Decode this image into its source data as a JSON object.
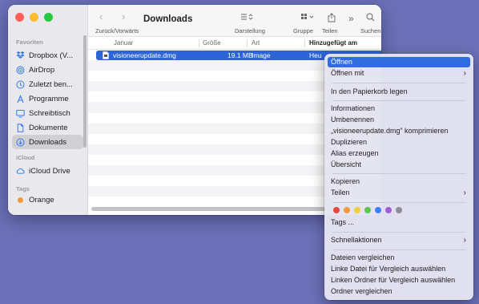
{
  "sidebar": {
    "favorites_header": "Favoriten",
    "items": [
      {
        "label": "Dropbox (V...",
        "icon": "dropbox-icon"
      },
      {
        "label": "AirDrop",
        "icon": "airdrop-icon"
      },
      {
        "label": "Zuletzt ben...",
        "icon": "clock-icon"
      },
      {
        "label": "Programme",
        "icon": "apps-icon"
      },
      {
        "label": "Schreibtisch",
        "icon": "desktop-icon"
      },
      {
        "label": "Dokumente",
        "icon": "document-icon"
      },
      {
        "label": "Downloads",
        "icon": "downloads-icon"
      }
    ],
    "icloud_header": "iCloud",
    "icloud_drive": "iCloud Drive",
    "tags_header": "Tags",
    "tag_orange": "Orange"
  },
  "toolbar": {
    "nav_label": "Zurück/Vorwärts",
    "title": "Downloads",
    "view_label": "Darstellung",
    "group_label": "Gruppe",
    "share_label": "Teilen",
    "search_label": "Suchen"
  },
  "columns": {
    "date": "Januar",
    "size": "Größe",
    "kind": "Art",
    "added": "Hinzugefügt am"
  },
  "file": {
    "name": "visioneerupdate.dmg",
    "size": "19.1 MB",
    "kind": "Image",
    "added": "Heu"
  },
  "menu": {
    "open": "Öffnen",
    "open_with": "Öffnen mit",
    "trash": "In den Papierkorb legen",
    "info": "Informationen",
    "rename": "Umbenennen",
    "compress": "„visioneerupdate.dmg“ komprimieren",
    "duplicate": "Duplizieren",
    "alias": "Alias erzeugen",
    "overview": "Übersicht",
    "copy": "Kopieren",
    "share": "Teilen",
    "tags": "Tags ...",
    "quick_actions": "Schnellaktionen",
    "compare_files": "Dateien vergleichen",
    "left_file": "Linke Datei für Vergleich auswählen",
    "left_folder": "Linken Ordner für Vergleich auswählen",
    "compare_folders": "Ordner vergleichen"
  },
  "colors": {
    "accent": "#2f6ce0",
    "tag_colors": [
      "#e8483f",
      "#f29a38",
      "#f4cd3a",
      "#5cc455",
      "#3b82f0",
      "#a05bd6",
      "#8e8e93"
    ]
  }
}
